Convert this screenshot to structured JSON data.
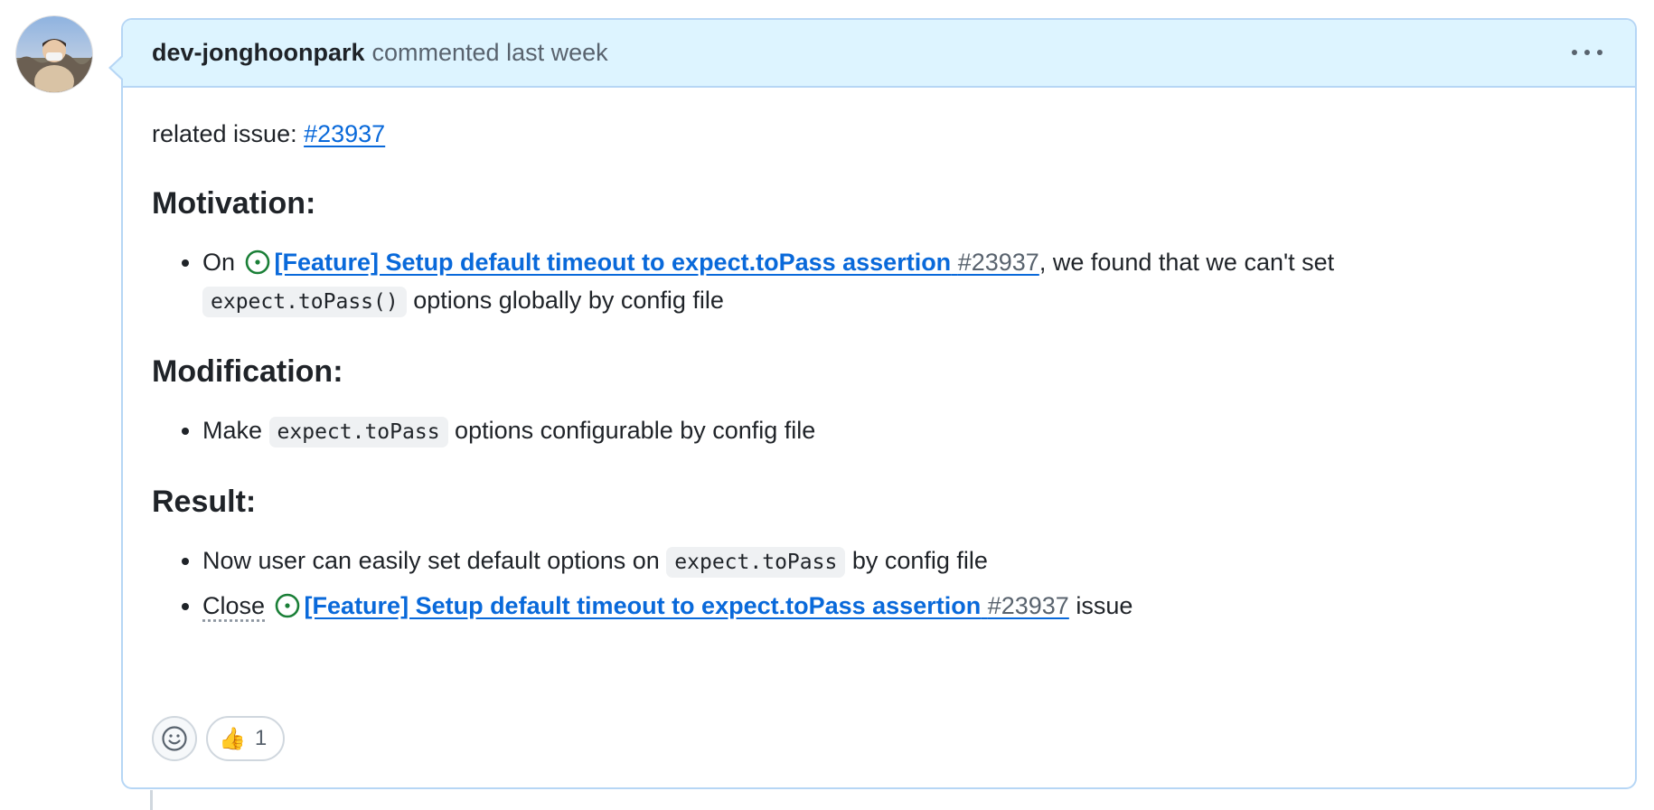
{
  "comment": {
    "author": "dev-jonghoonpark",
    "meta": "commented last week",
    "menu_icon": "kebab-horizontal-icon"
  },
  "body": {
    "related_label": "related issue: ",
    "related_link": "#23937",
    "motivation": {
      "heading": "Motivation:",
      "item_prefix": "On ",
      "issue_title": "[Feature] Setup default timeout to expect.toPass assertion",
      "issue_number": "#23937",
      "item_mid": ", we found that we can't set ",
      "code": "expect.toPass()",
      "item_suffix": " options globally by config file"
    },
    "modification": {
      "heading": "Modification:",
      "item_prefix": "Make ",
      "code": "expect.toPass",
      "item_suffix": " options configurable by config file"
    },
    "result": {
      "heading": "Result:",
      "item1_prefix": "Now user can easily set default options on ",
      "item1_code": "expect.toPass",
      "item1_suffix": " by config file",
      "item2_prefix": "Close",
      "issue_title": "[Feature] Setup default timeout to expect.toPass assertion",
      "issue_number": "#23937",
      "item2_suffix": " issue"
    }
  },
  "reactions": {
    "add_icon": "smiley-icon",
    "thumbs_emoji": "👍",
    "thumbs_count": "1"
  },
  "colors": {
    "header_bg": "#ddf4ff",
    "border": "#b6d6f5",
    "link": "#0969da",
    "open_issue": "#1a7f37"
  }
}
